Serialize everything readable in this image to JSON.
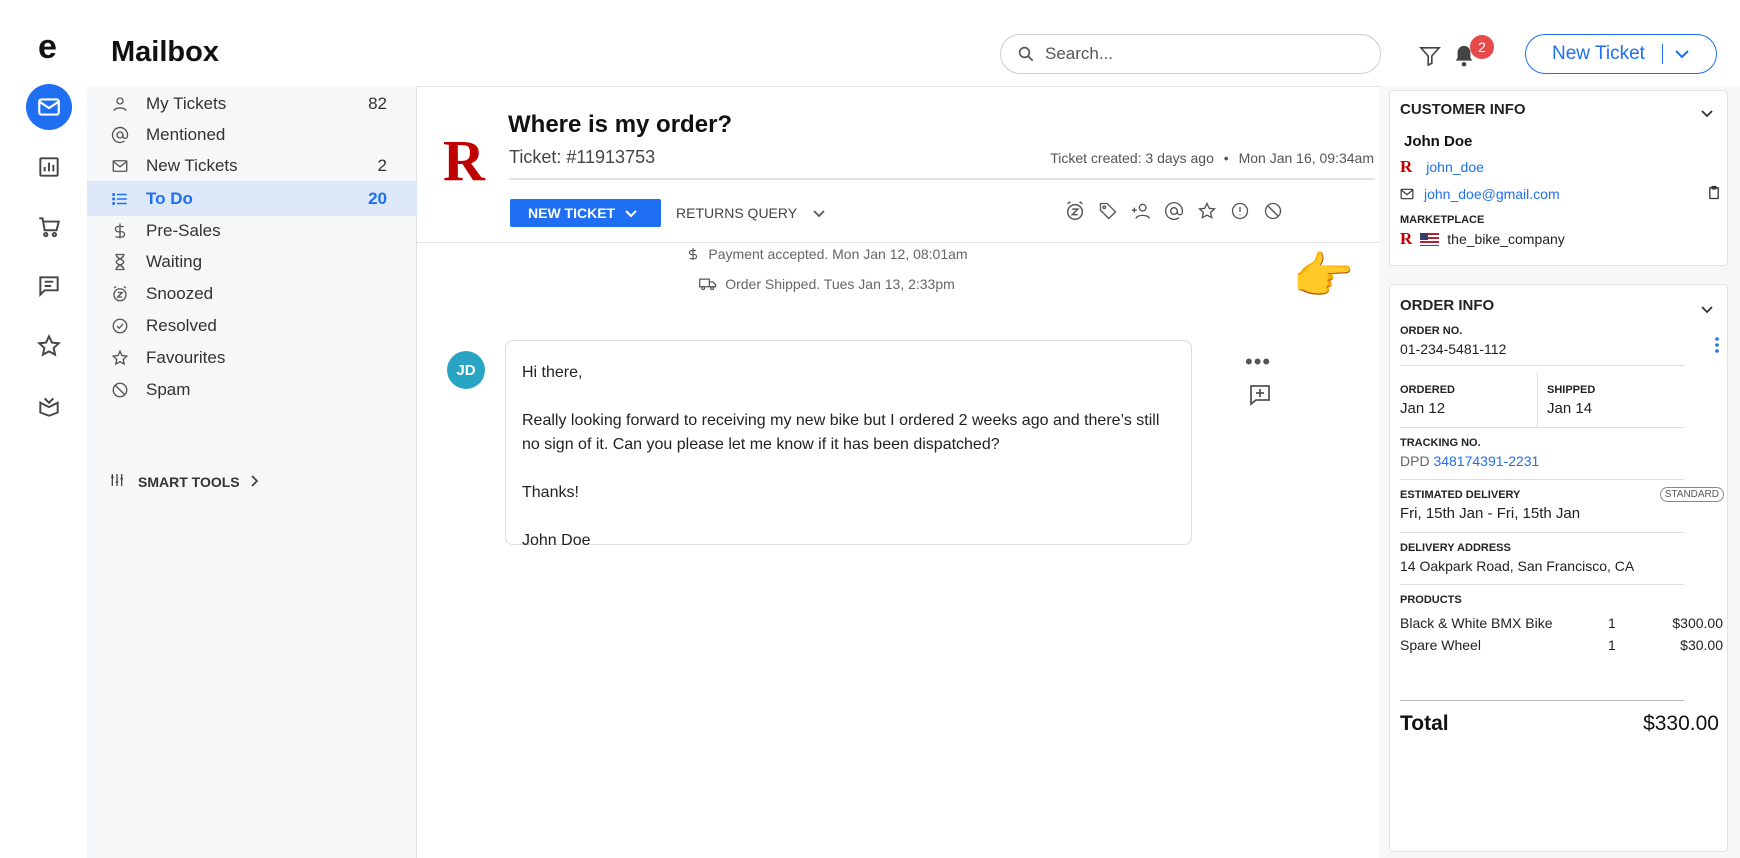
{
  "app": {
    "logo": "e",
    "title": "Mailbox"
  },
  "colors": {
    "accent": "#1e6ff1",
    "brand_red": "#bf0000",
    "badge_red": "#e64a4a",
    "avatar_teal": "#2aa4c4"
  },
  "rail": [
    "mail-icon",
    "chart-icon",
    "cart-icon",
    "chat-icon",
    "star-icon",
    "box-icon"
  ],
  "search": {
    "placeholder": "Search..."
  },
  "notifications": {
    "count": "2"
  },
  "new_ticket_button": "New Ticket",
  "sidebar": {
    "items": [
      {
        "label": "My Tickets",
        "count": "82",
        "icon": "person-icon"
      },
      {
        "label": "Mentioned",
        "count": "",
        "icon": "at-icon"
      },
      {
        "label": "New Tickets",
        "count": "2",
        "icon": "envelope-icon"
      },
      {
        "label": "To Do",
        "count": "20",
        "icon": "list-icon",
        "active": true
      },
      {
        "label": "Pre-Sales",
        "count": "",
        "icon": "dollar-icon"
      },
      {
        "label": "Waiting",
        "count": "",
        "icon": "hourglass-icon"
      },
      {
        "label": "Snoozed",
        "count": "",
        "icon": "snooze-icon"
      },
      {
        "label": "Resolved",
        "count": "",
        "icon": "check-circle-icon"
      },
      {
        "label": "Favourites",
        "count": "",
        "icon": "star-icon"
      },
      {
        "label": "Spam",
        "count": "",
        "icon": "block-icon"
      }
    ],
    "smart_tools": "SMART TOOLS"
  },
  "ticket": {
    "brand_logo": "R",
    "title": "Where is my order?",
    "number": "Ticket: #11913753",
    "created": "Ticket created: 3 days ago",
    "created_date": "Mon Jan 16, 09:34am",
    "status": "NEW TICKET",
    "category": "RETURNS QUERY",
    "events": [
      {
        "icon": "dollar-icon",
        "text": "Payment accepted. Mon Jan 12, 08:01am"
      },
      {
        "icon": "truck-icon",
        "text": "Order Shipped. Tues Jan 13, 2:33pm"
      }
    ],
    "pointer_emoji": "👉",
    "message": {
      "avatar": "JD",
      "paragraphs": [
        "Hi there,",
        "Really looking forward to receiving my new bike but I ordered 2 weeks ago and there’s still no sign of it. Can you please let me know if it has been dispatched?",
        "Thanks!",
        "John Doe"
      ]
    }
  },
  "customer": {
    "heading": "CUSTOMER INFO",
    "name": "John Doe",
    "username": "john_doe",
    "email": "john_doe@gmail.com",
    "marketplace_label": "MARKETPLACE",
    "marketplace": "the_bike_company"
  },
  "order": {
    "heading": "ORDER INFO",
    "order_no_label": "ORDER NO.",
    "order_no": "01-234-5481-112",
    "ordered_label": "ORDERED",
    "ordered": "Jan 12",
    "shipped_label": "SHIPPED",
    "shipped": "Jan 14",
    "tracking_label": "TRACKING NO.",
    "carrier": "DPD",
    "tracking_no": "348174391-2231",
    "est_label": "ESTIMATED DELIVERY",
    "est_badge": "STANDARD",
    "est_value": "Fri, 15th Jan - Fri, 15th Jan",
    "address_label": "DELIVERY ADDRESS",
    "address": "14 Oakpark Road, San Francisco, CA",
    "products_label": "PRODUCTS",
    "products": [
      {
        "name": "Black & White BMX Bike",
        "qty": "1",
        "price": "$300.00"
      },
      {
        "name": "Spare Wheel",
        "qty": "1",
        "price": "$30.00"
      }
    ],
    "total_label": "Total",
    "total": "$330.00"
  }
}
